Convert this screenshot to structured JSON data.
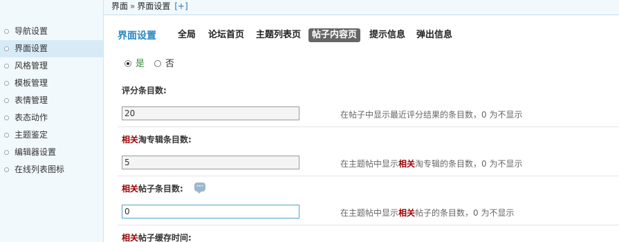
{
  "breadcrumb": {
    "parent": "界面",
    "separator": "»",
    "current": "界面设置",
    "add": "[+]"
  },
  "sidebar": {
    "items": [
      {
        "label": "导航设置",
        "active": false
      },
      {
        "label": "界面设置",
        "active": true
      },
      {
        "label": "风格管理",
        "active": false
      },
      {
        "label": "模板管理",
        "active": false
      },
      {
        "label": "表情管理",
        "active": false
      },
      {
        "label": "表态动作",
        "active": false
      },
      {
        "label": "主题鉴定",
        "active": false
      },
      {
        "label": "编辑器设置",
        "active": false
      },
      {
        "label": "在线列表图标",
        "active": false
      }
    ]
  },
  "main": {
    "title": "界面设置",
    "tabs": [
      {
        "label": "全局",
        "active": false
      },
      {
        "label": "论坛首页",
        "active": false
      },
      {
        "label": "主题列表页",
        "active": false
      },
      {
        "label": "帖子内容页",
        "active": true
      },
      {
        "label": "提示信息",
        "active": false
      },
      {
        "label": "弹出信息",
        "active": false
      }
    ],
    "radio": {
      "yes": "是",
      "no": "否",
      "selected": "是"
    },
    "settings": [
      {
        "label": "评分条目数:",
        "value": "20",
        "desc": "在帖子中显示最近评分结果的条目数，0 为不显示"
      },
      {
        "label_hl": "相关",
        "label_rest": "淘专辑条目数:",
        "value": "5",
        "desc_pre": "在主题帖中显示",
        "desc_hl": "相关",
        "desc_post": "淘专辑的条目数，0 为不显示"
      },
      {
        "label_hl": "相关",
        "label_rest": "帖子条目数:",
        "value": "0",
        "desc_pre": "在主题帖中显示",
        "desc_hl": "相关",
        "desc_post": "帖子的条目数，0 为不显示"
      },
      {
        "label_hl": "相关",
        "label_rest": "帖子缓存时间:"
      }
    ]
  }
}
